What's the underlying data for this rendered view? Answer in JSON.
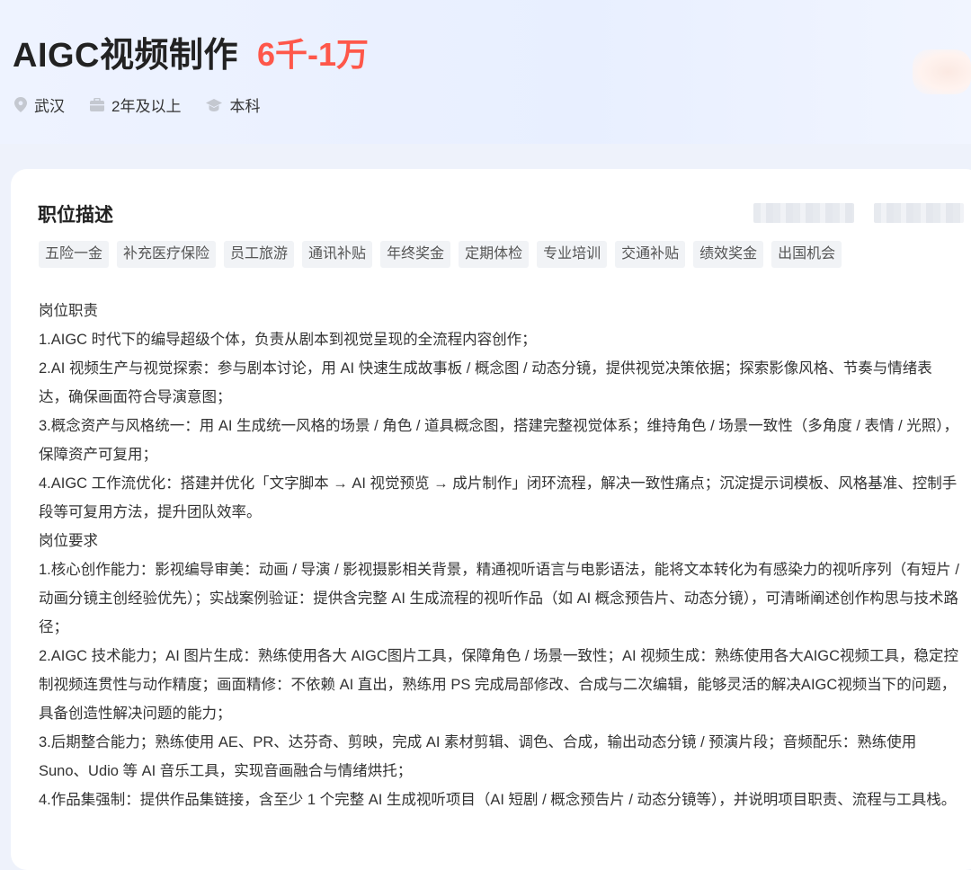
{
  "header": {
    "job_title": "AIGC视频制作",
    "salary": "6千-1万",
    "meta": [
      {
        "icon": "location-pin-icon",
        "label": "武汉"
      },
      {
        "icon": "briefcase-icon",
        "label": "2年及以上"
      },
      {
        "icon": "graduation-cap-icon",
        "label": "本科"
      }
    ],
    "salary_color": "#fe574a"
  },
  "section": {
    "title": "职位描述"
  },
  "tags": [
    "五险一金",
    "补充医疗保险",
    "员工旅游",
    "通讯补贴",
    "年终奖金",
    "定期体检",
    "专业培训",
    "交通补贴",
    "绩效奖金",
    "出国机会"
  ],
  "description": [
    "岗位职责",
    "1.AIGC 时代下的编导超级个体，负责从剧本到视觉呈现的全流程内容创作；",
    "2.AI 视频生产与视觉探索：参与剧本讨论，用 AI 快速生成故事板 / 概念图 / 动态分镜，提供视觉决策依据；探索影像风格、节奏与情绪表达，确保画面符合导演意图；",
    "3.概念资产与风格统一：用 AI 生成统一风格的场景 / 角色 / 道具概念图，搭建完整视觉体系；维持角色 / 场景一致性（多角度 / 表情 / 光照），保障资产可复用；",
    "4.AIGC 工作流优化：搭建并优化「文字脚本 → AI 视觉预览 → 成片制作」闭环流程，解决一致性痛点；沉淀提示词模板、风格基准、控制手段等可复用方法，提升团队效率。",
    "岗位要求",
    "1.核心创作能力：影视编导审美：动画 / 导演 / 影视摄影相关背景，精通视听语言与电影语法，能将文本转化为有感染力的视听序列（有短片 / 动画分镜主创经验优先）；实战案例验证：提供含完整 AI 生成流程的视听作品（如 AI 概念预告片、动态分镜），可清晰阐述创作构思与技术路径；",
    "2.AIGC 技术能力；AI 图片生成：熟练使用各大 AIGC图片工具，保障角色 / 场景一致性；AI 视频生成：熟练使用各大AIGC视频工具，稳定控制视频连贯性与动作精度；画面精修：不依赖 AI 直出，熟练用 PS 完成局部修改、合成与二次编辑，能够灵活的解决AIGC视频当下的问题，具备创造性解决问题的能力；",
    "3.后期整合能力；熟练使用 AE、PR、达芬奇、剪映，完成 AI 素材剪辑、调色、合成，输出动态分镜 / 预演片段；音频配乐：熟练使用 Suno、Udio 等 AI 音乐工具，实现音画融合与情绪烘托；",
    "4.作品集强制：提供作品集链接，含至少 1 个完整 AI 生成视听项目（AI 短剧 / 概念预告片 / 动态分镜等），并说明项目职责、流程与工具栈。"
  ]
}
